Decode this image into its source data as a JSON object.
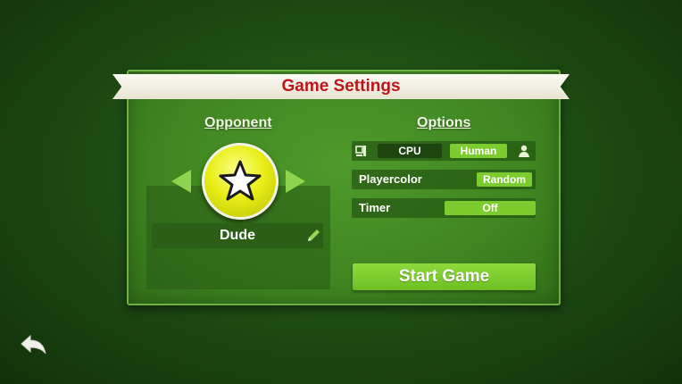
{
  "title": "Game Settings",
  "opponent": {
    "heading": "Opponent",
    "name": "Dude",
    "avatar_icon": "star-icon"
  },
  "options": {
    "heading": "Options",
    "player_type": {
      "cpu_label": "CPU",
      "human_label": "Human",
      "selected": "Human"
    },
    "playercolor": {
      "label": "Playercolor",
      "value": "Random"
    },
    "timer": {
      "label": "Timer",
      "value": "Off"
    }
  },
  "start_button": "Start Game",
  "colors": {
    "title_red": "#c0141b",
    "accent_green": "#7ccc2f",
    "avatar_yellow": "#e9ee17"
  }
}
